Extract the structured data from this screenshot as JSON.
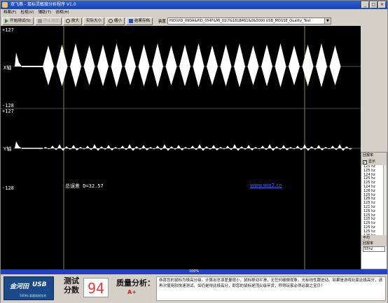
{
  "window": {
    "title": "双飞燕 - 鼠标灵敏度分析程序 V1.0",
    "controls": [
      "_",
      "□",
      "×"
    ]
  },
  "menu": [
    "档案(F)",
    "检视(V)",
    "辅助(T)",
    "说明(H)"
  ],
  "toolbar": {
    "start_label": "开始测试(S)",
    "stop_label": "停止测试",
    "zoom_in_label": "放大",
    "actual_size_label": "实际大小",
    "zoom_out_label": "缩小",
    "save_label": "结果存档",
    "device_label": "装置",
    "device_value": "HID\\VID_09DA&PID_054F&MI_01\\7&181B461&0&0000    USB_MOUSE_Quality_Test"
  },
  "plot": {
    "x_axis_label": "X轴",
    "y_axis_label": "Y轴",
    "x_top": "+127",
    "x_bottom": "-128",
    "y_top": "+127",
    "y_bottom": "-128",
    "total_error": "总误差 D=32.57",
    "link": "www.win2.cn"
  },
  "panel": {
    "title": "回报率",
    "show_label": "显示",
    "show_checked": true,
    "rates": [
      "125 hz",
      "125 hz",
      "124 hz",
      "125 hz",
      "125 hz",
      "124 hz",
      "126 hz",
      "125 hz",
      "126 hz",
      "125 hz",
      "121 hz",
      "125 hz",
      "125 hz",
      "125 hz",
      "125 hz",
      "125 hz",
      "125 hz",
      "125 hz",
      "54 hz",
      "54 hz",
      "51 hz",
      "51 hz"
    ],
    "avg_label": "平均",
    "rate_label": "回报率",
    "rate_value": "55hz"
  },
  "progress": {
    "value": 1.0,
    "label": "100%"
  },
  "result": {
    "logo_text_1": "金河田",
    "logo_text_2": "USB",
    "logo_sub": "500Hz 高速采样技术",
    "score_label_1": "测试",
    "score_label_2": "分数",
    "score": "94",
    "quality_label": "质量分析：",
    "grade": "A+",
    "analysis_text": "恭喜您的鼠标为极高分级。计算出总误差量很小，鼠标移动平滑，无任何细微现象，光标线性跟进动。如果是游戏玩家此极高分，请再次使用较快速测试，如仍是得此极高分，即您的鼠标是顶尖级年货，称得玩家必得必赢之宝贝！"
  },
  "colors": {
    "plot_bg": "#000000",
    "waveform": "#ffffff",
    "marker": "#8a8a3a",
    "progress": "#1f3fd0",
    "score": "#e23b3b"
  }
}
